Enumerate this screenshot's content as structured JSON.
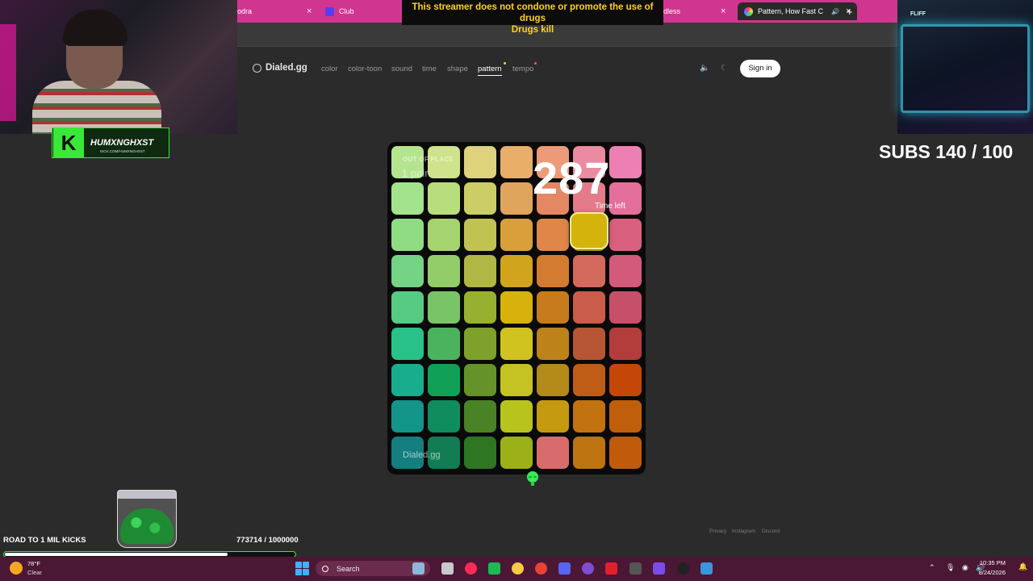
{
  "browser": {
    "tabs": [
      {
        "label": "odra",
        "close": "×"
      },
      {
        "label": "Club",
        "close": ""
      },
      {
        "label": "dless",
        "close": "×"
      },
      {
        "label": "Pattern, How Fast C",
        "close": "×"
      }
    ],
    "new_tab": "+"
  },
  "banner": {
    "line1": "This streamer does not condone or promote the use of drugs",
    "line2": "Drugs kill"
  },
  "site": {
    "brand": "Dialed.gg",
    "nav": [
      "color",
      "color-toon",
      "sound",
      "time",
      "shape",
      "pattern",
      "tempo"
    ],
    "active_nav": "pattern",
    "sign_in": "Sign in",
    "footer": [
      "Privacy",
      "Instagram",
      "Discord"
    ]
  },
  "game": {
    "mode_label": "OUT OF PLACE",
    "pairs": "1 pair",
    "timer": "287",
    "timer_label": "Time left",
    "watermark": "Dialed.gg",
    "grid_colors": [
      [
        "#b5e48f",
        "#cfe28c",
        "#ded27c",
        "#e9ae68",
        "#ec9a78",
        "#eb8aa2",
        "#ee7fb4"
      ],
      [
        "#a3e38b",
        "#b8dd7c",
        "#cdcd68",
        "#e0a55d",
        "#e48763",
        "#e47a8a",
        "#e56f9b"
      ],
      [
        "#8fdc84",
        "#a5d36f",
        "#c0c352",
        "#d99f3b",
        "#df8748",
        "#d4b40c",
        "#d9607e"
      ],
      [
        "#74d384",
        "#93cd69",
        "#b0b744",
        "#d0a41c",
        "#d37c2f",
        "#d4695e",
        "#d45a7c"
      ],
      [
        "#57ca83",
        "#79c466",
        "#98b02f",
        "#d7b10c",
        "#c77b1d",
        "#c95c4b",
        "#c6506a"
      ],
      [
        "#28c188",
        "#4bb35e",
        "#7da12a",
        "#d1c31f",
        "#bd821a",
        "#b65634",
        "#b33d3a"
      ],
      [
        "#18ae8d",
        "#10a056",
        "#66922a",
        "#c5c223",
        "#b48a18",
        "#bf5c16",
        "#c54708"
      ],
      [
        "#14958a",
        "#0f8d5c",
        "#4a8226",
        "#b8c41e",
        "#c59a10",
        "#c2720f",
        "#bf5f0c"
      ],
      [
        "#157e7f",
        "#127c55",
        "#2e7621",
        "#9cb017",
        "#d86c6c",
        "#bd7411",
        "#c05b0c"
      ]
    ]
  },
  "stream": {
    "channel_name": "HUMXNGHXST",
    "channel_url": "KICK.COM/HUMXNGHXST",
    "sponsor": "FLIFF",
    "subs": "SUBS 140 / 100",
    "goal_label": "ROAD TO 1 MIL KICKS",
    "goal_count": "773714 / 1000000",
    "goal_progress": 0.7737
  },
  "taskbar": {
    "temp": "78°F",
    "condition": "Clear",
    "search": "Search",
    "time": "10:35 PM",
    "date": "8/24/2026",
    "apps": [
      "files-icon",
      "music-icon",
      "spotify-icon",
      "folder-icon",
      "chrome-icon",
      "discord-icon",
      "tor-icon",
      "opera-icon",
      "steam-helper-icon",
      "obs-icon",
      "terminal-icon",
      "chrome-active-icon",
      "steam-icon"
    ]
  }
}
